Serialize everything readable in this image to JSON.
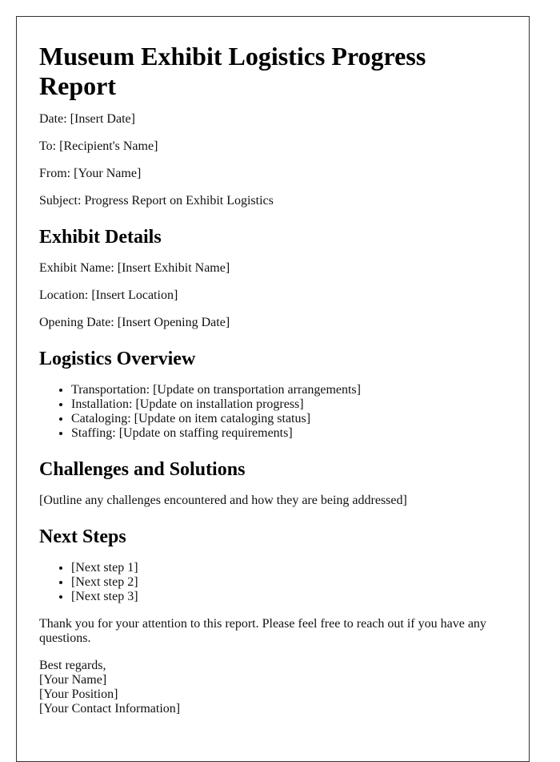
{
  "document": {
    "title": "Museum Exhibit Logistics Progress Report",
    "header_fields": [
      {
        "label": "Date:",
        "value": "[Insert Date]"
      },
      {
        "label": "To:",
        "value": "[Recipient's Name]"
      },
      {
        "label": "From:",
        "value": "[Your Name]"
      },
      {
        "label": "Subject:",
        "value": "Progress Report on Exhibit Logistics"
      }
    ],
    "sections": {
      "exhibit_details": {
        "heading": "Exhibit Details",
        "fields": [
          {
            "label": "Exhibit Name:",
            "value": "[Insert Exhibit Name]"
          },
          {
            "label": "Location:",
            "value": "[Insert Location]"
          },
          {
            "label": "Opening Date:",
            "value": "[Insert Opening Date]"
          }
        ]
      },
      "logistics_overview": {
        "heading": "Logistics Overview",
        "items": [
          {
            "label": "Transportation:",
            "value": "[Update on transportation arrangements]"
          },
          {
            "label": "Installation:",
            "value": "[Update on installation progress]"
          },
          {
            "label": "Cataloging:",
            "value": "[Update on item cataloging status]"
          },
          {
            "label": "Staffing:",
            "value": "[Update on staffing requirements]"
          }
        ]
      },
      "challenges": {
        "heading": "Challenges and Solutions",
        "text": "[Outline any challenges encountered and how they are being addressed]"
      },
      "next_steps": {
        "heading": "Next Steps",
        "items": [
          "[Next step 1]",
          "[Next step 2]",
          "[Next step 3]"
        ]
      }
    },
    "closing": {
      "text": "Thank you for your attention to this report. Please feel free to reach out if you have any questions.",
      "signoff": "Best regards,",
      "name": "[Your Name]",
      "position": "[Your Position]",
      "contact": "[Your Contact Information]"
    }
  }
}
